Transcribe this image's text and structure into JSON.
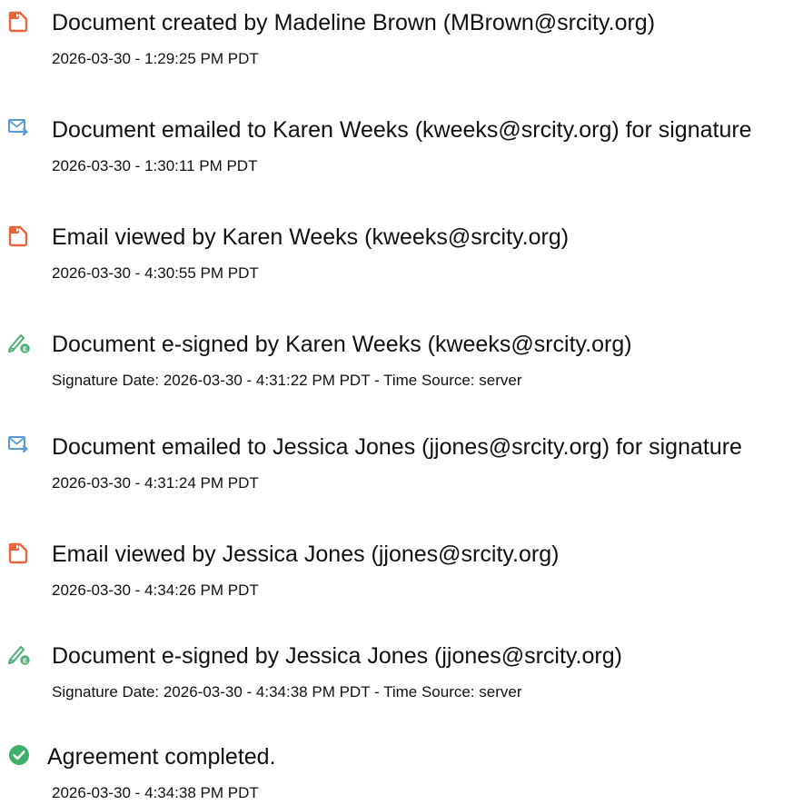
{
  "events": [
    {
      "icon": "document-created-icon",
      "title": "Document created by Madeline Brown (MBrown@srcity.org)",
      "detail": "2026-03-30 - 1:29:25 PM PDT"
    },
    {
      "icon": "email-sent-icon",
      "title": "Document emailed to Karen Weeks (kweeks@srcity.org) for signature",
      "detail": "2026-03-30 - 1:30:11 PM PDT"
    },
    {
      "icon": "email-viewed-icon",
      "title": "Email viewed by Karen Weeks (kweeks@srcity.org)",
      "detail": "2026-03-30 - 4:30:55 PM PDT"
    },
    {
      "icon": "e-signed-icon",
      "title": "Document e-signed by Karen Weeks (kweeks@srcity.org)",
      "detail": "Signature Date: 2026-03-30 - 4:31:22 PM PDT - Time Source: server"
    },
    {
      "icon": "email-sent-icon",
      "title": "Document emailed to Jessica Jones (jjones@srcity.org) for signature",
      "detail": "2026-03-30 - 4:31:24 PM PDT"
    },
    {
      "icon": "email-viewed-icon",
      "title": "Email viewed by Jessica Jones (jjones@srcity.org)",
      "detail": "2026-03-30 - 4:34:26 PM PDT"
    },
    {
      "icon": "e-signed-icon",
      "title": "Document e-signed by Jessica Jones (jjones@srcity.org)",
      "detail": "Signature Date: 2026-03-30 - 4:34:38 PM PDT - Time Source: server"
    },
    {
      "icon": "agreement-completed-icon",
      "title": "Agreement completed.",
      "detail": "2026-03-30 - 4:34:38 PM PDT"
    }
  ],
  "colors": {
    "document_icon": "#e8643c",
    "email_icon": "#5b9bd5",
    "signed_icon": "#4caf78",
    "completed_icon": "#3fae6b",
    "text": "#111111"
  }
}
